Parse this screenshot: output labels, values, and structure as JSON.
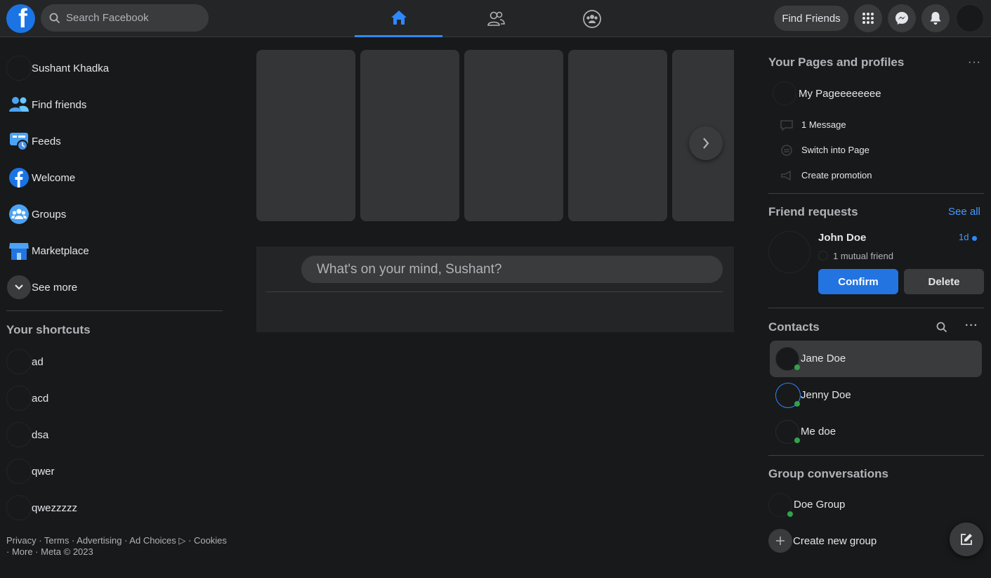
{
  "topbar": {
    "logo_letter": "f",
    "search_placeholder": "Search Facebook",
    "find_friends_label": "Find Friends",
    "nav_tabs": [
      "home-icon",
      "friends-icon",
      "groups-icon"
    ],
    "accent": "#2d88ff"
  },
  "left": {
    "items": [
      {
        "label": "Sushant Khadka",
        "icon": "avatar"
      },
      {
        "label": "Find friends",
        "icon": "friends-icon"
      },
      {
        "label": "Feeds",
        "icon": "feeds-icon"
      },
      {
        "label": "Welcome",
        "icon": "facebook-icon"
      },
      {
        "label": "Groups",
        "icon": "groups-icon"
      },
      {
        "label": "Marketplace",
        "icon": "marketplace-icon"
      },
      {
        "label": "See more",
        "icon": "chevron-down-icon"
      }
    ],
    "shortcuts_title": "Your shortcuts",
    "shortcuts": [
      "ad",
      "acd",
      "dsa",
      "qwer",
      "qwezzzzz"
    ],
    "footer_line1": "Privacy · Terms · Advertising · Ad Choices ▷ · Cookies",
    "footer_line2": "· More · Meta © 2023"
  },
  "composer": {
    "placeholder": "What's on your mind, Sushant?"
  },
  "right": {
    "pages_title": "Your Pages and profiles",
    "page_name": "My Pageeeeeeee",
    "page_actions": [
      "1 Message",
      "Switch into Page",
      "Create promotion"
    ],
    "friend_requests_title": "Friend requests",
    "see_all": "See all",
    "request": {
      "name": "John Doe",
      "time": "1d",
      "mutual": "1 mutual friend",
      "confirm": "Confirm",
      "delete": "Delete"
    },
    "contacts_title": "Contacts",
    "contacts": [
      "Jane Doe",
      "Jenny Doe",
      "Me doe"
    ],
    "group_conv_title": "Group conversations",
    "groups": [
      "Doe Group"
    ],
    "create_group": "Create new group"
  }
}
